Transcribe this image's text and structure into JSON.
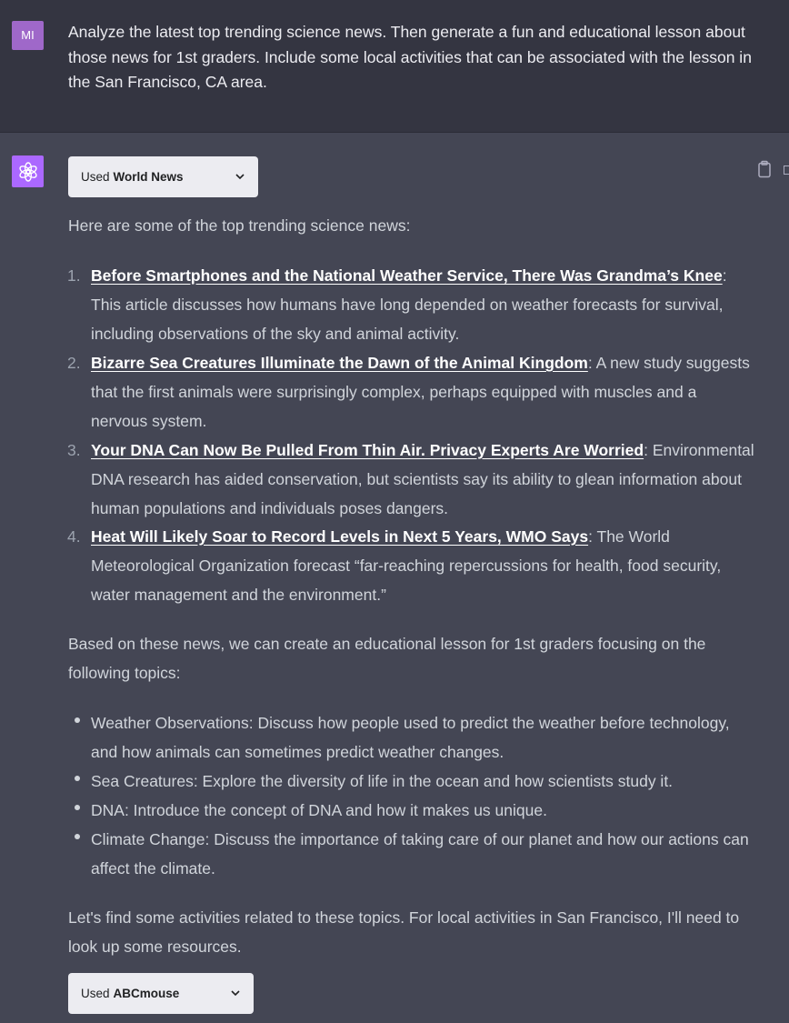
{
  "user_message": {
    "avatar_initials": "MI",
    "text": "Analyze the latest top trending science news.  Then generate a fun and educational lesson about those news for 1st graders.  Include some local activities that can be associated with the lesson in the San Francisco, CA area."
  },
  "assistant": {
    "plugin_1": {
      "prefix": "Used",
      "name": "World News"
    },
    "intro": "Here are some of the top trending science news:",
    "news": [
      {
        "number": "1.",
        "title": "Before Smartphones and the National Weather Service, There Was Grandma’s Knee",
        "description": ": This article discusses how humans have long depended on weather forecasts for survival, including observations of the sky and animal activity."
      },
      {
        "number": "2.",
        "title": "Bizarre Sea Creatures Illuminate the Dawn of the Animal Kingdom",
        "description": ": A new study suggests that the first animals were surprisingly complex, perhaps equipped with muscles and a nervous system."
      },
      {
        "number": "3.",
        "title": "Your DNA Can Now Be Pulled From Thin Air. Privacy Experts Are Worried",
        "description": ": Environmental DNA research has aided conservation, but scientists say its ability to glean information about human populations and individuals poses dangers."
      },
      {
        "number": "4.",
        "title": "Heat Will Likely Soar to Record Levels in Next 5 Years, WMO Says",
        "description": ": The World Meteorological Organization forecast “far-reaching repercussions for health, food security, water management and the environment.”"
      }
    ],
    "based_on": "Based on these news, we can create an educational lesson for 1st graders focusing on the following topics:",
    "topics": [
      "Weather Observations: Discuss how people used to predict the weather before technology, and how animals can sometimes predict weather changes.",
      "Sea Creatures: Explore the diversity of life in the ocean and how scientists study it.",
      "DNA: Introduce the concept of DNA and how it makes us unique.",
      "Climate Change: Discuss the importance of taking care of our planet and how our actions can affect the climate."
    ],
    "closing": "Let's find some activities related to these topics. For local activities in San Francisco, I'll need to look up some resources.",
    "plugin_2": {
      "prefix": "Used",
      "name": "ABCmouse"
    }
  },
  "colors": {
    "user_bg": "#343541",
    "assistant_bg": "#444654",
    "user_avatar": "#9f68c9",
    "assistant_avatar": "#ab68ff",
    "text": "#d1d5db",
    "link": "#ffffff"
  },
  "icons": [
    "openai-logo-icon",
    "clipboard-icon",
    "chevron-down-icon"
  ]
}
